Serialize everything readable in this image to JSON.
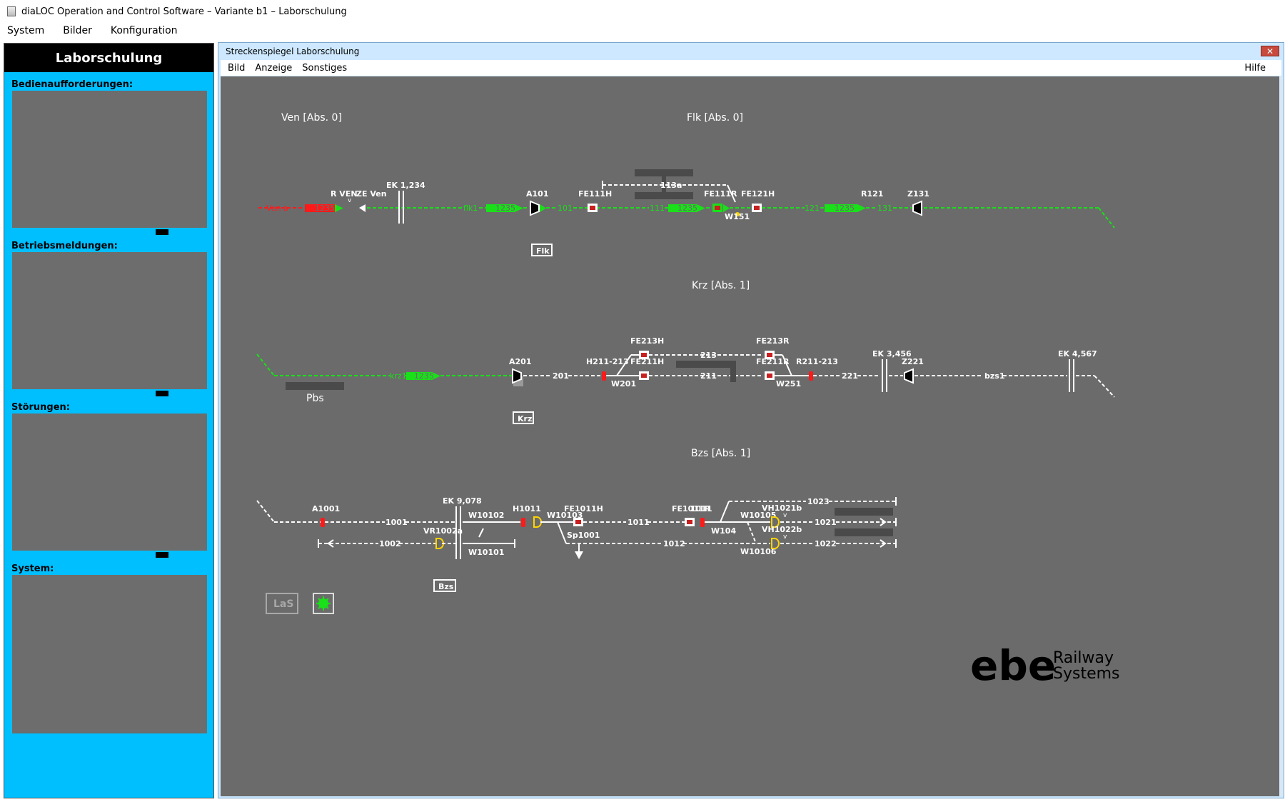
{
  "window": {
    "title": "diaLOC Operation and Control Software – Variante b1 – Laborschulung"
  },
  "menu": [
    "System",
    "Bilder",
    "Konfiguration"
  ],
  "left_panel": {
    "header": "Laborschulung",
    "sections": [
      {
        "title": "Bedienaufforderungen:"
      },
      {
        "title": "Betriebsmeldungen:"
      },
      {
        "title": "Störungen:"
      },
      {
        "title": "System:"
      }
    ]
  },
  "child_window": {
    "title": "Streckenspiegel Laborschulung",
    "close": "✕",
    "menu": [
      "Bild",
      "Anzeige",
      "Sonstiges"
    ],
    "help": "Hilfe"
  },
  "stations": {
    "ven": "Ven [Abs. 0]",
    "flk": "Flk [Abs. 0]",
    "krz": "Krz [Abs. 1]",
    "bzs": "Bzs [Abs. 1]"
  },
  "station_boxes": {
    "flk": "Flk",
    "krz": "Krz",
    "bzs": "Bzs"
  },
  "pbs": "Pbs",
  "las": "LaS",
  "logo": {
    "ebe": "ebe",
    "line1": "Railway",
    "line2": "Systems"
  },
  "row1": {
    "train_red": "1235",
    "ven_a": "Ven a",
    "r_ven": "R VEN",
    "ze_ven": "ZE Ven",
    "ek": "EK 1,234",
    "flk1": "flk1",
    "train1": "1235",
    "a101": "A101",
    "t101": "101",
    "fe111h": "FE111H",
    "t111": "111",
    "t113a": "113a",
    "train2": "1235",
    "fe111r": "FE111R",
    "fe121h": "FE121H",
    "w151": "W151",
    "t121": "121",
    "train3": "1235",
    "r121": "R121",
    "t131": "131",
    "z131": "Z131",
    "v": "v"
  },
  "row2": {
    "krz1": "krz1",
    "train": "1235",
    "a201": "A201",
    "t201": "201",
    "h211": "H211-213",
    "fe213h": "FE213H",
    "fe211h": "FE211H",
    "t213": "213",
    "t211": "211",
    "w201": "W201",
    "fe213r": "FE213R",
    "fe211r": "FE211R",
    "r211": "R211-213",
    "w251": "W251",
    "t221": "221",
    "ek3": "EK 3,456",
    "z221": "Z221",
    "bzs1": "bzs1",
    "ek4": "EK 4,567"
  },
  "row3": {
    "a1001": "A1001",
    "t1001": "1001",
    "t1002": "1002",
    "ek9": "EK 9,078",
    "vr1002a": "VR1002a",
    "w10102": "W10102",
    "w10101": "W10101",
    "h1011": "H1011",
    "w10103": "W10103",
    "fe1011h": "FE1011H",
    "sp1001": "Sp1001",
    "t1011": "1011",
    "t1012": "1012",
    "fe1011r": "FE1011R",
    "r1011": "1011",
    "w104": "W104",
    "w10105": "W10105",
    "w10106": "W10106",
    "vh1021b": "VH1021b",
    "vh1022b": "VH1022b",
    "t1021": "1021",
    "t1022": "1022",
    "t1023": "1023",
    "v": "v"
  },
  "colors": {
    "green": "#19e019",
    "red": "#ff1a1a",
    "canvas": "#6b6b6b",
    "panel": "#00bfff"
  }
}
